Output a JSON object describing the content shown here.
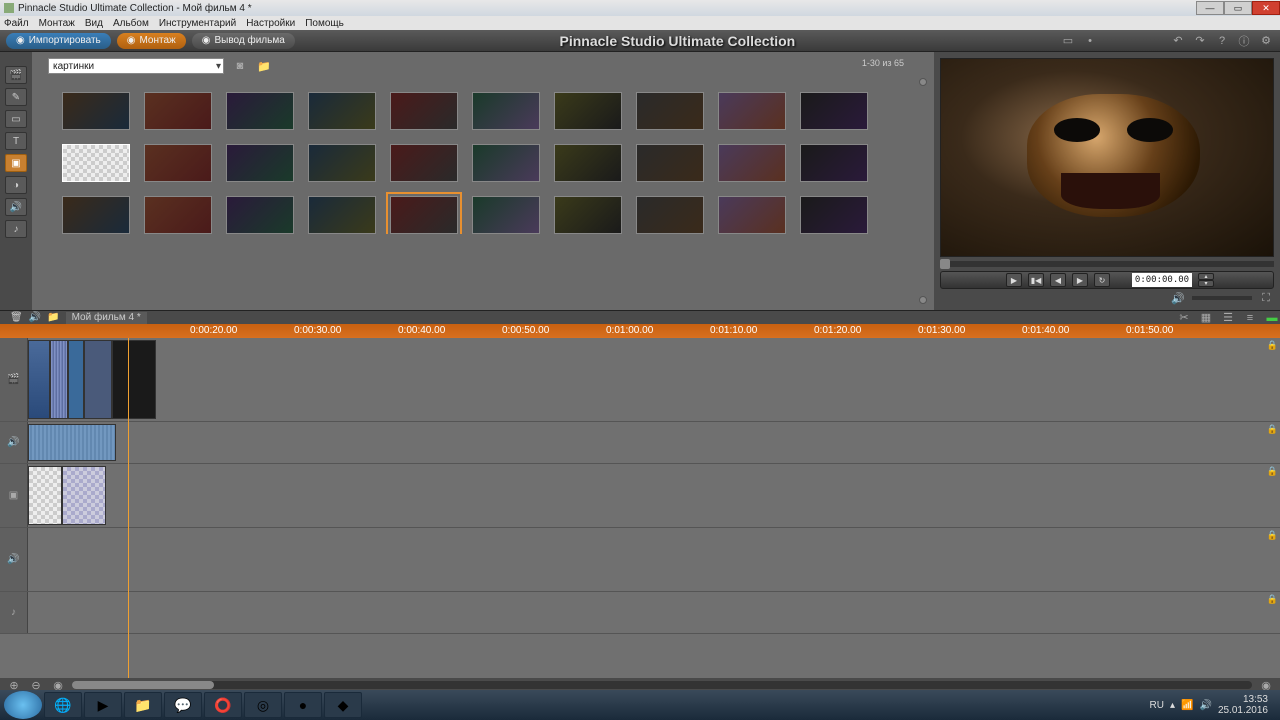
{
  "window": {
    "title": "Pinnacle Studio Ultimate Collection - Мой фильм 4 *"
  },
  "menu": [
    "Файл",
    "Монтаж",
    "Вид",
    "Альбом",
    "Инструментарий",
    "Настройки",
    "Помощь"
  ],
  "toolbar": {
    "import": "Импортировать",
    "montage": "Монтаж",
    "export": "Вывод фильма",
    "app_title": "Pinnacle Studio Ultimate Collection"
  },
  "left_tools": [
    {
      "name": "video-clips-tool",
      "glyph": "🎬"
    },
    {
      "name": "transitions-tool",
      "glyph": "✎"
    },
    {
      "name": "titles-tool",
      "glyph": "▭"
    },
    {
      "name": "text-tool",
      "glyph": "T"
    },
    {
      "name": "photos-tool",
      "glyph": "▣",
      "active": true
    },
    {
      "name": "color-tool",
      "glyph": "◑"
    },
    {
      "name": "audio-tool",
      "glyph": "🔊"
    },
    {
      "name": "music-tool",
      "glyph": "♪"
    }
  ],
  "library": {
    "dropdown": "картинки",
    "count_label": "1-30 из 65",
    "thumbs_count": 30,
    "special_index": 10,
    "selected_index": 24
  },
  "preview": {
    "timecode": "0:00:00.00"
  },
  "timeline_header": {
    "filename": "Мой фильм 4 *"
  },
  "ruler_ticks": [
    "0:00:20.00",
    "0:00:30.00",
    "0:00:40.00",
    "0:00:50.00",
    "0:01:00.00",
    "0:01:10.00",
    "0:01:20.00",
    "0:01:30.00",
    "0:01:40.00",
    "0:01:50.00"
  ],
  "tracks": [
    {
      "name": "video-track",
      "icon": "🎬"
    },
    {
      "name": "audio-track",
      "icon": "🔊"
    },
    {
      "name": "overlay-track",
      "icon": "▣"
    },
    {
      "name": "audio2-track",
      "icon": "🔊"
    },
    {
      "name": "music-track",
      "icon": "♪"
    }
  ],
  "taskbar": {
    "icons": [
      "🌐",
      "▶",
      "📁",
      "💬",
      "⭕",
      "◎",
      "●",
      "◆"
    ],
    "lang": "RU",
    "time": "13:53",
    "date": "25.01.2016"
  }
}
